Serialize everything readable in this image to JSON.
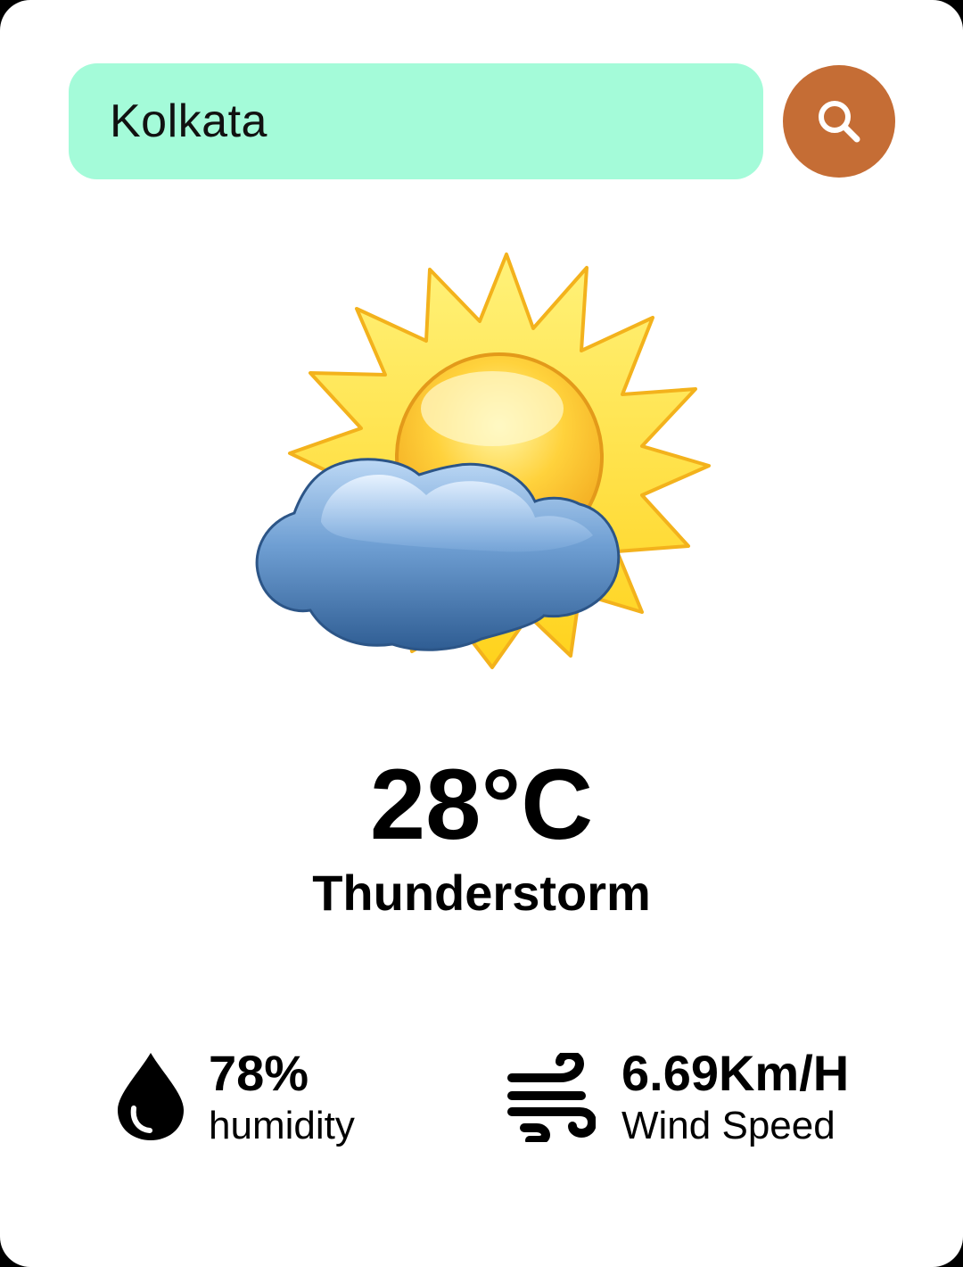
{
  "search": {
    "value": "Kolkata",
    "button_icon": "search-icon"
  },
  "weather": {
    "icon": "partly-cloudy-sun-icon",
    "temperature": "28°C",
    "condition": "Thunderstorm"
  },
  "stats": {
    "humidity": {
      "icon": "water-drop-icon",
      "value": "78%",
      "label": "humidity"
    },
    "wind": {
      "icon": "wind-icon",
      "value": "6.69Km/H",
      "label": "Wind Speed"
    }
  },
  "colors": {
    "search_field_bg": "#a4fbd9",
    "search_button_bg": "#c56d35",
    "card_bg": "#ffffff",
    "text": "#000000"
  }
}
